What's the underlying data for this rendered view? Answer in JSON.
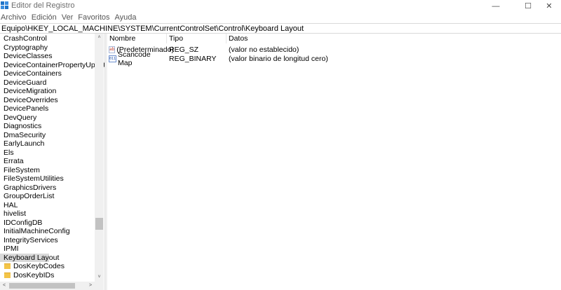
{
  "window": {
    "title": "Editor del Registro",
    "minimize_glyph": "—",
    "maximize_glyph": "☐",
    "close_glyph": "✕",
    "accent_color": "#1e73c8"
  },
  "menu": [
    "Archivo",
    "Edición",
    "Ver",
    "Favoritos",
    "Ayuda"
  ],
  "address": "Equipo\\HKEY_LOCAL_MACHINE\\SYSTEM\\CurrentControlSet\\Control\\Keyboard Layout",
  "tree": {
    "items": [
      "CrashControl",
      "Cryptography",
      "DeviceClasses",
      "DeviceContainerPropertyUpdateEv",
      "DeviceContainers",
      "DeviceGuard",
      "DeviceMigration",
      "DeviceOverrides",
      "DevicePanels",
      "DevQuery",
      "Diagnostics",
      "DmaSecurity",
      "EarlyLaunch",
      "Els",
      "Errata",
      "FileSystem",
      "FileSystemUtilities",
      "GraphicsDrivers",
      "GroupOrderList",
      "HAL",
      "hivelist",
      "IDConfigDB",
      "InitialMachineConfig",
      "IntegrityServices",
      "IPMI"
    ],
    "selected": "Keyboard Layout",
    "children": [
      "DosKeybCodes",
      "DosKeybIDs"
    ],
    "scroll_up": "˄",
    "scroll_down": "˅",
    "scroll_left": "<",
    "scroll_right": ">"
  },
  "list": {
    "columns": [
      "Nombre",
      "Tipo",
      "Datos"
    ],
    "rows": [
      {
        "icon": "string-value-icon",
        "icon_text": "ab",
        "name": "(Predeterminado)",
        "type": "REG_SZ",
        "data": "(valor no establecido)"
      },
      {
        "icon": "binary-value-icon",
        "icon_text": "011",
        "name": "Scancode Map",
        "type": "REG_BINARY",
        "data": "(valor binario de longitud cero)"
      }
    ]
  }
}
